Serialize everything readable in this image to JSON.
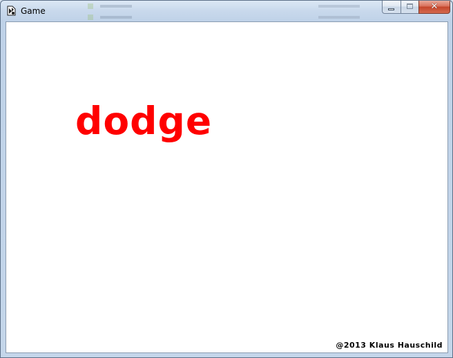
{
  "window": {
    "title": "Game",
    "controls": {
      "minimize": "minimize",
      "maximize": "maximize",
      "close": "✕"
    },
    "icon": "game-app-icon"
  },
  "game": {
    "word": "dodge",
    "copyright": "@2013 Klaus Hauschild",
    "colors": {
      "word": "#ff0000",
      "background": "#ffffff",
      "copyright": "#000000"
    }
  }
}
